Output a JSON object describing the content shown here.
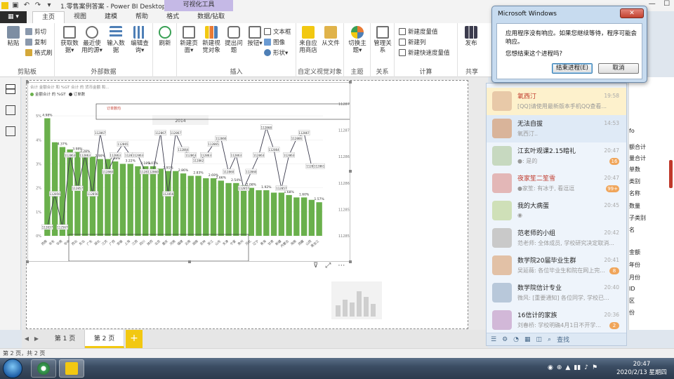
{
  "window": {
    "title": "1.零售案例答案 - Power BI Desktop",
    "context_group": "可视化工具",
    "controls": [
      "—",
      "☐"
    ]
  },
  "tabs": {
    "file": "▦ ▾",
    "items": [
      "主页",
      "视图",
      "建模",
      "帮助",
      "格式",
      "数据/钻取"
    ],
    "active": "主页"
  },
  "ribbon": {
    "clipboard": {
      "paste": "粘贴",
      "cut": "剪切",
      "copy": "复制",
      "format_painter": "格式刷",
      "label": "剪贴板"
    },
    "external_data": {
      "get_data": "获取数据▾",
      "recent_sources": "最近使用的源▾",
      "enter_data": "输入数据",
      "edit_queries": "编辑查询▾",
      "label": "外部数据"
    },
    "refresh": "刷新",
    "insert": {
      "new_page": "新建页面▾",
      "new_visual": "新建视觉对象",
      "ask_question": "提出问题",
      "buttons": "按钮▾",
      "text_box": "文本框",
      "image": "图像",
      "shapes": "形状▾",
      "label": "插入"
    },
    "custom_visuals": {
      "marketplace": "来自应用商店",
      "from_file": "从文件",
      "label": "自定义视觉对象"
    },
    "themes": {
      "switch_theme": "切换主题▾",
      "label": "主题"
    },
    "relationships": {
      "manage": "管理关系",
      "label": "关系"
    },
    "calculations": {
      "new_measure": "新建度量值",
      "new_column": "新建列",
      "new_quick_measure": "新建快速度量值",
      "label": "计算"
    },
    "share": {
      "publish": "发布",
      "label": "共享"
    }
  },
  "visual": {
    "header": "合计 金额合计 和 %GT 合计 的 货币金额 和...",
    "legend": [
      {
        "label": "金额合计 的 %GT",
        "color": "#5b9bd5"
      },
      {
        "label": "订单数",
        "color": "#333333"
      }
    ],
    "accent_color": "#6ab04c",
    "line_color": "#3b3b4d",
    "toolbar": [
      "⊽",
      "⤢",
      "⋯"
    ]
  },
  "chart_data": {
    "type": "bar",
    "categories": [
      "西南",
      "华东",
      "华南",
      "华中",
      "西北",
      "东北",
      "广东",
      "湖北",
      "江苏",
      "广西",
      "安徽",
      "上海",
      "江西",
      "四川",
      "陕西",
      "北京",
      "重庆",
      "河南",
      "福建",
      "云南",
      "湖南",
      "吉林",
      "浙江",
      "山东",
      "天津",
      "宁夏",
      "贵州",
      "河北",
      "辽宁",
      "青海",
      "甘肃",
      "新疆",
      "内蒙古",
      "海南",
      "西藏",
      "山西",
      "黑龙江"
    ],
    "values": [
      4.9,
      3.9,
      3.7,
      3.6,
      3.5,
      3.4,
      3.3,
      3.2,
      3.2,
      3.1,
      3.0,
      3.0,
      2.9,
      2.9,
      2.9,
      2.8,
      2.7,
      2.7,
      2.6,
      2.5,
      2.5,
      2.4,
      2.4,
      2.3,
      2.2,
      2.2,
      2.1,
      2.0,
      1.9,
      1.9,
      1.8,
      1.8,
      1.7,
      1.6,
      1.6,
      1.5,
      1.4
    ],
    "bar_labels": [
      "4.98%",
      "4.37%",
      "3.98%",
      "3.28%",
      "2.90%",
      "2.28%",
      "3.22%",
      "3.18%",
      "3.07%",
      "2.91%",
      "2.86%",
      "2.83%",
      "2.69%",
      "2.66%",
      "2.54%",
      "2.08%",
      "1.92%",
      "1.87%",
      "1.68%",
      "1.60%",
      "1.57%"
    ],
    "line_values": [
      112837,
      112856,
      112567,
      112863,
      112857,
      112863,
      112856,
      112867,
      112860,
      112863,
      112865,
      112863,
      112863,
      112860,
      112860,
      112867,
      112856,
      112867,
      112864,
      112863,
      112862,
      112863,
      112865,
      112866,
      112860,
      112863,
      112857,
      112860,
      112863,
      112868,
      112864,
      112857,
      112863,
      112866,
      112867,
      112861,
      112861
    ],
    "annotations": [
      "订单数均",
      "2014"
    ],
    "ylabel_left_ticks": [
      "0%",
      "1%",
      "2%",
      "3%",
      "4%",
      "5%"
    ],
    "ylabel_right_ticks": [
      "112850",
      "112855",
      "112860",
      "112865",
      "112870",
      "112875"
    ],
    "ylim": [
      0,
      5.5
    ],
    "grid": true,
    "legend_position": "top-left"
  },
  "pages": {
    "tabs": [
      "第 1 页",
      "第 2 页"
    ],
    "active": "第 2 页",
    "add": "+",
    "nav_prev": "◀",
    "nav_next": "▶"
  },
  "status": {
    "text": "第 2 页，共 2 页"
  },
  "dialog": {
    "title": "Microsoft Windows",
    "close": "✕",
    "message": "应用程序没有响应。如果您继续等待，程序可能会响应。",
    "question": "您想结束这个进程吗?",
    "end_button": "结束进程(E)",
    "cancel_button": "取消"
  },
  "qq": {
    "items": [
      {
        "name": "氧西汀",
        "msg": "[QQ]请使用最新版本手机QQ查看...",
        "time": "19:58",
        "red": true,
        "badge": ""
      },
      {
        "name": "无法自拔",
        "msg": "氧西汀..",
        "time": "14:53",
        "red": false,
        "badge": ""
      },
      {
        "name": "江玄叶观课2.15暗礼",
        "msg": "●: 是的",
        "time": "20:47",
        "red": false,
        "badge": "16"
      },
      {
        "name": "夜家笙二笙雪",
        "msg": "●家笙: 有冰于, 看逗逗",
        "time": "20:47",
        "red": true,
        "badge": "99+"
      },
      {
        "name": "我的大病蛋",
        "msg": "◉",
        "time": "20:45",
        "red": false,
        "badge": ""
      },
      {
        "name": "范老师的小组",
        "msg": "范老师: 全体成员, 学校研究决定取消...",
        "time": "20:42",
        "red": false,
        "badge": ""
      },
      {
        "name": "数学院20届毕业生群",
        "msg": "吴延薇: 各位毕业生和院在网上完...",
        "time": "20:41",
        "red": false,
        "badge": "8"
      },
      {
        "name": "数学院信计专业",
        "msg": "微风: [重要通知] 各位同学, 学校已...",
        "time": "20:40",
        "red": false,
        "badge": ""
      },
      {
        "name": "16信计的家族",
        "msg": "刘春桥: 学校明确4月1日不开学...",
        "time": "20:36",
        "red": false,
        "badge": "2"
      }
    ],
    "bottom_search": "查找"
  },
  "fields": [
    "fo",
    "额合计",
    "量合计",
    "单数",
    "类别",
    "名称",
    "数量",
    "子类别",
    "名",
    "金额",
    "年份",
    "月份",
    "ID",
    "区",
    "份"
  ],
  "taskbar": {
    "clock_time": "20:47",
    "clock_date": "2020/2/13 星期四",
    "tray": [
      "◉",
      "⊕",
      "▲",
      "▮▮",
      "♪",
      "⚑"
    ]
  }
}
